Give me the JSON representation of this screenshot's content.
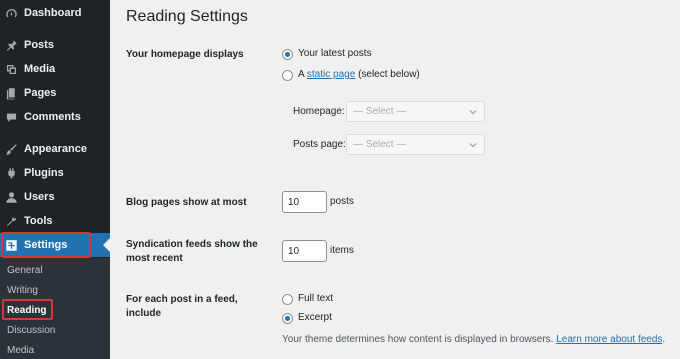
{
  "sidebar": {
    "menu": [
      {
        "label": "Dashboard",
        "icon": "dashboard-icon"
      },
      {
        "label": "Posts",
        "icon": "pin-icon"
      },
      {
        "label": "Media",
        "icon": "media-icon"
      },
      {
        "label": "Pages",
        "icon": "pages-icon"
      },
      {
        "label": "Comments",
        "icon": "comments-icon"
      },
      {
        "label": "Appearance",
        "icon": "brush-icon"
      },
      {
        "label": "Plugins",
        "icon": "plugin-icon"
      },
      {
        "label": "Users",
        "icon": "user-icon"
      },
      {
        "label": "Tools",
        "icon": "wrench-icon"
      },
      {
        "label": "Settings",
        "icon": "settings-icon"
      }
    ],
    "submenu": [
      "General",
      "Writing",
      "Reading",
      "Discussion",
      "Media"
    ]
  },
  "page": {
    "title": "Reading Settings",
    "homepage": {
      "label": "Your homepage displays",
      "option_latest": "Your latest posts",
      "option_static_prefix": "A",
      "option_static_link": "static page",
      "option_static_suffix": "(select below)",
      "homepage_label": "Homepage:",
      "homepage_value": "— Select —",
      "posts_page_label": "Posts page:",
      "posts_page_value": "— Select —"
    },
    "blog_pages": {
      "label": "Blog pages show at most",
      "value": "10",
      "unit": "posts"
    },
    "syndication": {
      "label_line1": "Syndication feeds show the",
      "label_line2": "most recent",
      "value": "10",
      "unit": "items"
    },
    "feed": {
      "label_line1": "For each post in a feed,",
      "label_line2": "include",
      "option_full": "Full text",
      "option_excerpt": "Excerpt",
      "description": "Your theme determines how content is displayed in browsers.",
      "learn_more": "Learn more about feeds"
    }
  },
  "colors": {
    "sidebar_bg": "#1d2327",
    "active_bg": "#2271b1",
    "highlight": "#d63638",
    "content_bg": "#f0f0f1"
  }
}
